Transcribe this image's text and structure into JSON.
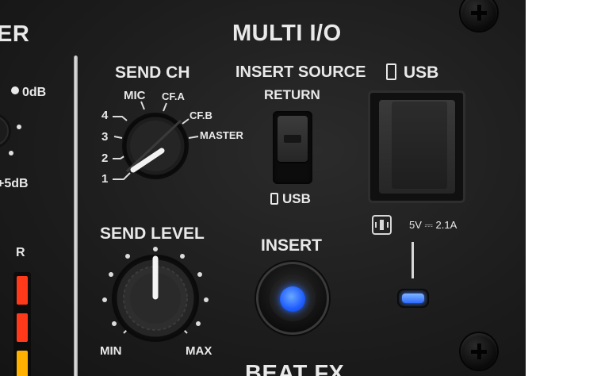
{
  "section": {
    "title": "MULTI I/O",
    "left_partial_title": "ER",
    "bottom_partial_title": "BEAT FX"
  },
  "left_panel": {
    "db_top": "0dB",
    "db_bottom": "+5dB",
    "channel_r": "R",
    "meter_colors": [
      "#ff3a1a",
      "#ff3a1a",
      "#ffb000"
    ]
  },
  "send_ch": {
    "title": "SEND CH",
    "positions": [
      "1",
      "2",
      "3",
      "4",
      "MIC",
      "CF.A",
      "CF.B",
      "MASTER"
    ],
    "selected": "1"
  },
  "send_level": {
    "title": "SEND LEVEL",
    "min_label": "MIN",
    "max_label": "MAX",
    "level": 0.5
  },
  "insert_source": {
    "title": "INSERT SOURCE",
    "top_label": "RETURN",
    "bottom_label": "USB",
    "selected": "RETURN"
  },
  "insert_button": {
    "label": "INSERT",
    "led_color": "#2b6bff",
    "lit": true
  },
  "usb": {
    "title": "USB",
    "power_rating": "5V ⎓ 2.1A",
    "indicator_color": "#2d6bff"
  },
  "icons": [
    "usb-stick-icon",
    "usb-stick-icon",
    "device-connection-icon",
    "screw-icon"
  ]
}
